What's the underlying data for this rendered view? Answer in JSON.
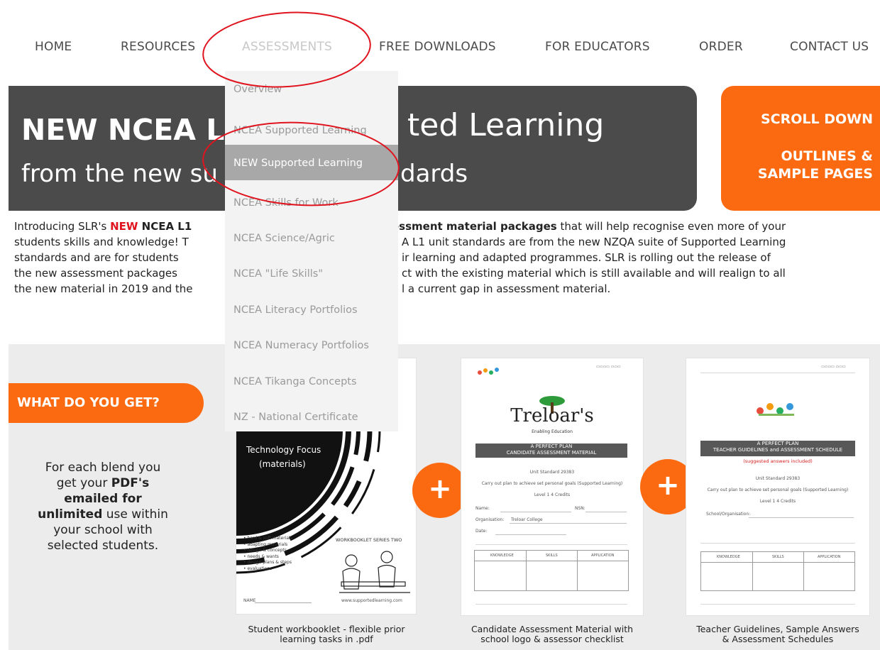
{
  "nav": {
    "items": [
      {
        "label": "HOME"
      },
      {
        "label": "RESOURCES"
      },
      {
        "label": "ASSESSMENTS"
      },
      {
        "label": "FREE DOWNLOADS"
      },
      {
        "label": "FOR EDUCATORS"
      },
      {
        "label": "ORDER"
      },
      {
        "label": "CONTACT US"
      }
    ],
    "active_index": 2
  },
  "dropdown": {
    "items": [
      {
        "label": "Overview"
      },
      {
        "label": "NCEA Supported Learning"
      },
      {
        "label": "NEW Supported Learning"
      },
      {
        "label": "NCEA Skills for Work"
      },
      {
        "label": "NCEA Science/Agric"
      },
      {
        "label": "NCEA \"Life Skills\""
      },
      {
        "label": "NCEA Literacy Portfolios"
      },
      {
        "label": "NCEA Numeracy Portfolios"
      },
      {
        "label": "NCEA Tikanga Concepts"
      },
      {
        "label": "NZ - National Certificate"
      }
    ],
    "highlighted_index": 2
  },
  "hero": {
    "title_bold_visible": "NEW NCEA L",
    "title_right": "ted Learning",
    "subtitle_left": "from the new su",
    "subtitle_right": "dards",
    "cta_line1": "SCROLL DOWN",
    "cta_line2": "OUTLINES &",
    "cta_line3": "SAMPLE PAGES"
  },
  "intro": {
    "l1a": "Introducing SLR's ",
    "l1_new": "NEW",
    "l1b": " NCEA L1",
    "l1c": "essment material packages",
    "l1d": " that will help recognise even more of your",
    "l2a": "students skills and knowledge!  T",
    "l2b": "A L1 unit standards are from the new NZQA suite of Supported Learning",
    "l3a": "standards and are for students",
    "l3b": "ir learning and adapted programmes.  SLR is rolling out the release of",
    "l4a": "the new assessment packages",
    "l4b": "ct with the existing material which is still available and will realign to all",
    "l5a": "the new material in 2019 and the",
    "l5b": "l a current gap in assessment material."
  },
  "get": {
    "button": "WHAT DO YOU GET?",
    "p1": "For each blend you",
    "p2a": "get your ",
    "p2b": "PDF's",
    "p3": "emailed for",
    "p4a": "unlimited",
    "p4b": " use within",
    "p5": "your school with",
    "p6": "selected students."
  },
  "doc1": {
    "focus1": "Technology Focus",
    "focus2": "(materials)",
    "side_title": "WORKBOOKLET SERIES TWO",
    "bullets": [
      "hard & soft materials",
      "adapting materials",
      "design & concepts",
      "needs & wants",
      "design plans & steps",
      "evaluations"
    ],
    "name_label": "NAME",
    "url": "www.supportedlearning.com",
    "caption1": "Student workbooklet - flexible prior",
    "caption2": "learning tasks in .pdf"
  },
  "doc2": {
    "logo": "Treloar's",
    "logo_sub": "Enabling Education",
    "bar1": "A PERFECT PLAN",
    "bar2": "CANDIDATE ASSESSMENT MATERIAL",
    "unit": "Unit Standard 29383",
    "carry": "Carry out plan to achieve set personal goals (Supported Learning)",
    "level": "Level 1  4 Credits",
    "f_name": "Name:",
    "f_nsn": "NSN:",
    "f_org": "Organisation:",
    "f_org_val": "Treloar College",
    "f_date": "Date:",
    "col1": "KNOWLEDGE",
    "col2": "SKILLS",
    "col3": "APPLICATION",
    "caption1": "Candidate Assessment Material with",
    "caption2": "school logo & assessor checklist"
  },
  "doc3": {
    "bar1": "A PERFECT PLAN",
    "bar2": "TEACHER GUIDELINES and ASSESSMENT SCHEDULE",
    "red": "(suggested answers included)",
    "unit": "Unit Standard 29383",
    "carry": "Carry out plan to achieve set personal goals (Supported Learning)",
    "level": "Level 1  4 Credits",
    "school": "School/Organisation:",
    "col1": "KNOWLEDGE",
    "col2": "SKILLS",
    "col3": "APPLICATION",
    "caption1": "Teacher Guidelines, Sample Answers",
    "caption2": "& Assessment Schedules"
  },
  "plus_symbol": "+",
  "colors": {
    "accent": "#fb6a10",
    "hero_bg": "#4b4b4b",
    "red": "#e0141e",
    "annotation": "#e0141e"
  },
  "icons": [
    "plus-icon",
    "treloars-tree-logo",
    "sunflower-kids-logo"
  ]
}
